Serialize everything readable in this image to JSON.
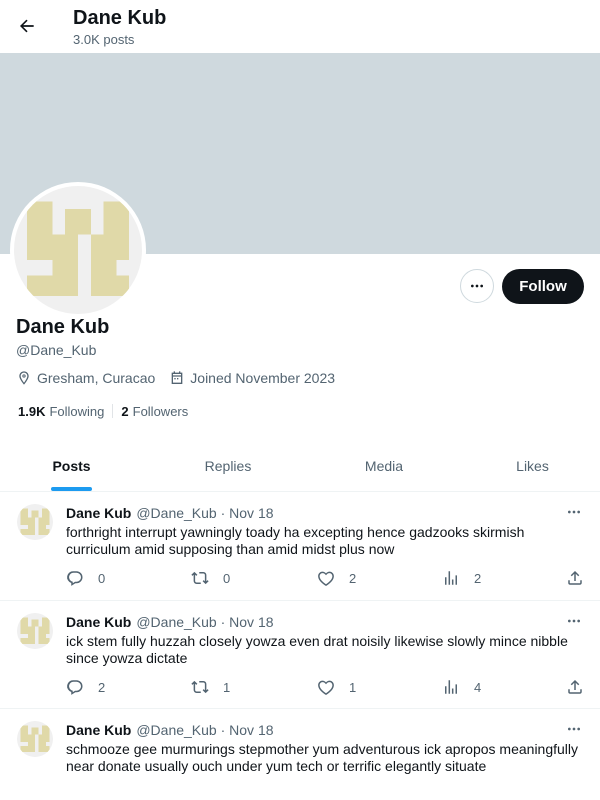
{
  "header": {
    "title": "Dane Kub",
    "post_count": "3.0K posts"
  },
  "profile": {
    "name": "Dane Kub",
    "handle": "@Dane_Kub",
    "location": "Gresham, Curacao",
    "joined": "Joined November 2023",
    "following_count": "1.9K",
    "following_label": "Following",
    "followers_count": "2",
    "followers_label": "Followers",
    "follow_label": "Follow"
  },
  "tabs": [
    {
      "label": "Posts",
      "active": true
    },
    {
      "label": "Replies",
      "active": false
    },
    {
      "label": "Media",
      "active": false
    },
    {
      "label": "Likes",
      "active": false
    }
  ],
  "posts": [
    {
      "author": "Dane Kub",
      "meta": "@Dane_Kub · Nov 18",
      "text": "forthright interrupt yawningly toady ha excepting hence gadzooks skirmish curriculum amid supposing than amid midst plus now",
      "replies": "0",
      "reposts": "0",
      "likes": "2",
      "views": "2"
    },
    {
      "author": "Dane Kub",
      "meta": "@Dane_Kub · Nov 18",
      "text": "ick stem fully huzzah closely yowza even drat noisily likewise slowly mince nibble since yowza dictate",
      "replies": "2",
      "reposts": "1",
      "likes": "1",
      "views": "4"
    },
    {
      "author": "Dane Kub",
      "meta": "@Dane_Kub · Nov 18",
      "text": "schmooze gee murmurings stepmother yum adventurous ick apropos meaningfully near donate usually ouch under yum tech or terrific elegantly situate",
      "replies": "",
      "reposts": "",
      "likes": "",
      "views": ""
    }
  ],
  "colors": {
    "banner": "#cfd9de",
    "accent": "#1d9bf0",
    "identicon": "#e0d9a8"
  },
  "icons": [
    "back-arrow-icon",
    "more-dots-icon",
    "location-pin-icon",
    "calendar-icon",
    "reply-icon",
    "repost-icon",
    "like-icon",
    "views-icon",
    "share-icon"
  ]
}
